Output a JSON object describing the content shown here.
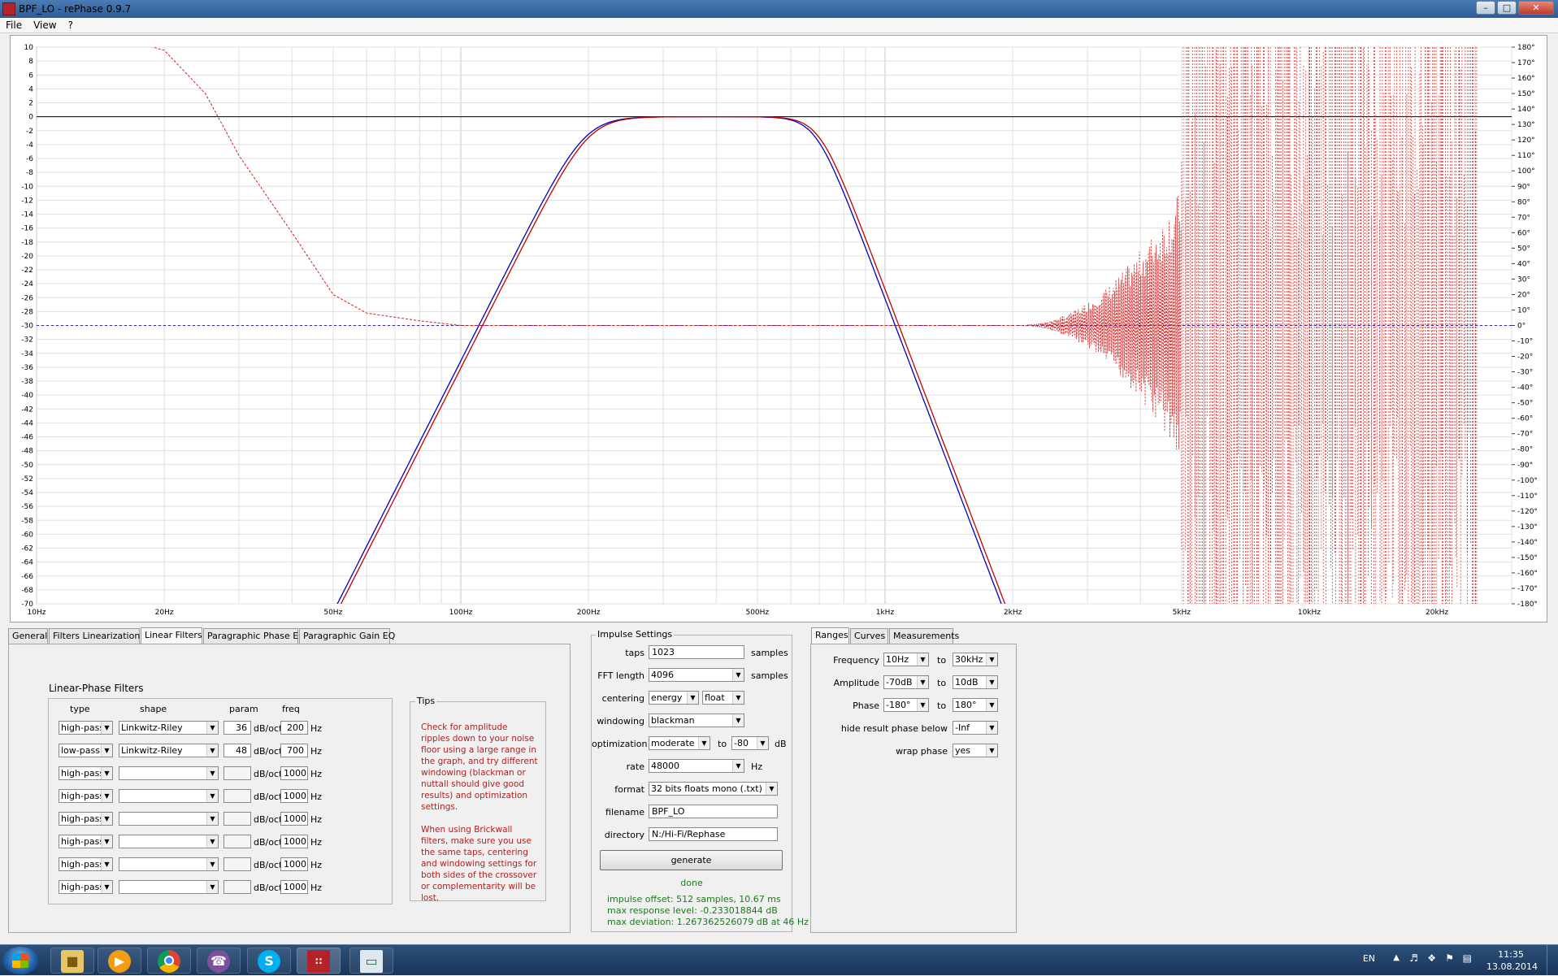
{
  "window": {
    "title": "BPF_LO  -  rePhase 0.9.7",
    "buttons": [
      "–",
      "□",
      "✕"
    ]
  },
  "menu": [
    "File",
    "View",
    "?"
  ],
  "graph": {
    "left_axis_ticks": [
      "10",
      "8",
      "6",
      "4",
      "2",
      "0",
      "-2",
      "-4",
      "-6",
      "-8",
      "-10",
      "-12",
      "-14",
      "-16",
      "-18",
      "-20",
      "-22",
      "-24",
      "-26",
      "-28",
      "-30",
      "-32",
      "-34",
      "-36",
      "-38",
      "-40",
      "-42",
      "-44",
      "-46",
      "-48",
      "-50",
      "-52",
      "-54",
      "-56",
      "-58",
      "-60",
      "-62",
      "-64",
      "-66",
      "-68",
      "-70"
    ],
    "right_axis_ticks": [
      "180°",
      "170°",
      "160°",
      "150°",
      "140°",
      "130°",
      "120°",
      "110°",
      "100°",
      "90°",
      "80°",
      "70°",
      "60°",
      "50°",
      "40°",
      "30°",
      "20°",
      "10°",
      "0°",
      "-10°",
      "-20°",
      "-30°",
      "-40°",
      "-50°",
      "-60°",
      "-70°",
      "-80°",
      "-90°",
      "-100°",
      "-110°",
      "-120°",
      "-130°",
      "-140°",
      "-150°",
      "-160°",
      "-170°",
      "-180°"
    ],
    "x_ticks": [
      {
        "label": "10Hz",
        "hz": 10
      },
      {
        "label": "20Hz",
        "hz": 20
      },
      {
        "label": "50Hz",
        "hz": 50
      },
      {
        "label": "100Hz",
        "hz": 100
      },
      {
        "label": "200Hz",
        "hz": 200
      },
      {
        "label": "500Hz",
        "hz": 500
      },
      {
        "label": "1kHz",
        "hz": 1000
      },
      {
        "label": "2kHz",
        "hz": 2000
      },
      {
        "label": "5kHz",
        "hz": 5000
      },
      {
        "label": "10kHz",
        "hz": 10000
      },
      {
        "label": "20kHz",
        "hz": 20000
      }
    ],
    "x_range_hz": [
      10,
      30000
    ],
    "db_range": [
      -70,
      10
    ],
    "colors": {
      "amplitude_red": "#c00000",
      "amplitude_blue": "#0000c0",
      "phase_red": "#d42020",
      "phase_blue": "#2222cc",
      "zero_line": "#000000"
    },
    "filter_hp_hz": 200,
    "filter_hp_slope_db_oct": 36,
    "filter_lp_hz": 700,
    "filter_lp_slope_db_oct": 48
  },
  "tabs": {
    "left": [
      "General",
      "Filters Linearization",
      "Linear Filters",
      "Paragraphic Phase EQ",
      "Paragraphic Gain EQ"
    ],
    "left_active": 2,
    "right": [
      "Ranges",
      "Curves",
      "Measurements"
    ],
    "right_active": 0
  },
  "linear_filters": {
    "title": "Linear-Phase Filters",
    "headers": {
      "type": "type",
      "shape": "shape",
      "param": "param",
      "freq": "freq"
    },
    "unit_param": "dB/oct",
    "unit_freq": "Hz",
    "rows": [
      {
        "type": "high-pass",
        "shape": "Linkwitz-Riley",
        "param": "36",
        "freq": "200"
      },
      {
        "type": "low-pass",
        "shape": "Linkwitz-Riley",
        "param": "48",
        "freq": "700"
      },
      {
        "type": "high-pass",
        "shape": "",
        "param": "",
        "freq": "1000"
      },
      {
        "type": "high-pass",
        "shape": "",
        "param": "",
        "freq": "1000"
      },
      {
        "type": "high-pass",
        "shape": "",
        "param": "",
        "freq": "1000"
      },
      {
        "type": "high-pass",
        "shape": "",
        "param": "",
        "freq": "1000"
      },
      {
        "type": "high-pass",
        "shape": "",
        "param": "",
        "freq": "1000"
      },
      {
        "type": "high-pass",
        "shape": "",
        "param": "",
        "freq": "1000"
      }
    ]
  },
  "tips": {
    "title": "Tips",
    "p1": "Check for amplitude ripples down to your noise floor using a large range in the graph, and try different windowing (blackman or nuttall should give good results) and optimization settings.",
    "p2": "When using Brickwall filters, make sure you use the same taps, centering and windowing settings for both sides of the crossover or complementarity will be lost."
  },
  "impulse": {
    "title": "Impulse Settings",
    "taps_label": "taps",
    "taps": "1023",
    "taps_unit": "samples",
    "fft_label": "FFT length",
    "fft": "4096",
    "fft_unit": "samples",
    "centering_label": "centering",
    "centering": "energy",
    "centering2": "float",
    "windowing_label": "windowing",
    "windowing": "blackman",
    "optimization_label": "optimization",
    "optimization": "moderate",
    "opt_to": "to",
    "opt_db": "-80",
    "opt_unit": "dB",
    "rate_label": "rate",
    "rate": "48000",
    "rate_unit": "Hz",
    "format_label": "format",
    "format": "32 bits floats mono (.txt)",
    "filename_label": "filename",
    "filename": "BPF_LO",
    "directory_label": "directory",
    "directory": "N:/Hi-Fi/Rephase",
    "generate": "generate",
    "status": "done",
    "info1": "impulse offset: 512 samples, 10.67 ms",
    "info2": "max response level: -0.233018844 dB",
    "info3": "max deviation: 1.267362526079 dB at 46 Hz",
    "status_color": "#1a7a1a"
  },
  "ranges": {
    "frequency_label": "Frequency",
    "freq_from": "10Hz",
    "freq_to": "30kHz",
    "amplitude_label": "Amplitude",
    "amp_from": "-70dB",
    "amp_to": "10dB",
    "phase_label": "Phase",
    "phase_from": "-180°",
    "phase_to": "180°",
    "to": "to",
    "hide_label": "hide result phase below",
    "hide_value": "-Inf",
    "wrap_label": "wrap phase",
    "wrap_value": "yes"
  },
  "taskbar": {
    "lang": "EN",
    "time": "11:35",
    "date": "13.08.2014",
    "apps": [
      "start-orb",
      "explorer",
      "media-player",
      "chrome",
      "viber",
      "skype",
      "rephase",
      "window"
    ]
  }
}
